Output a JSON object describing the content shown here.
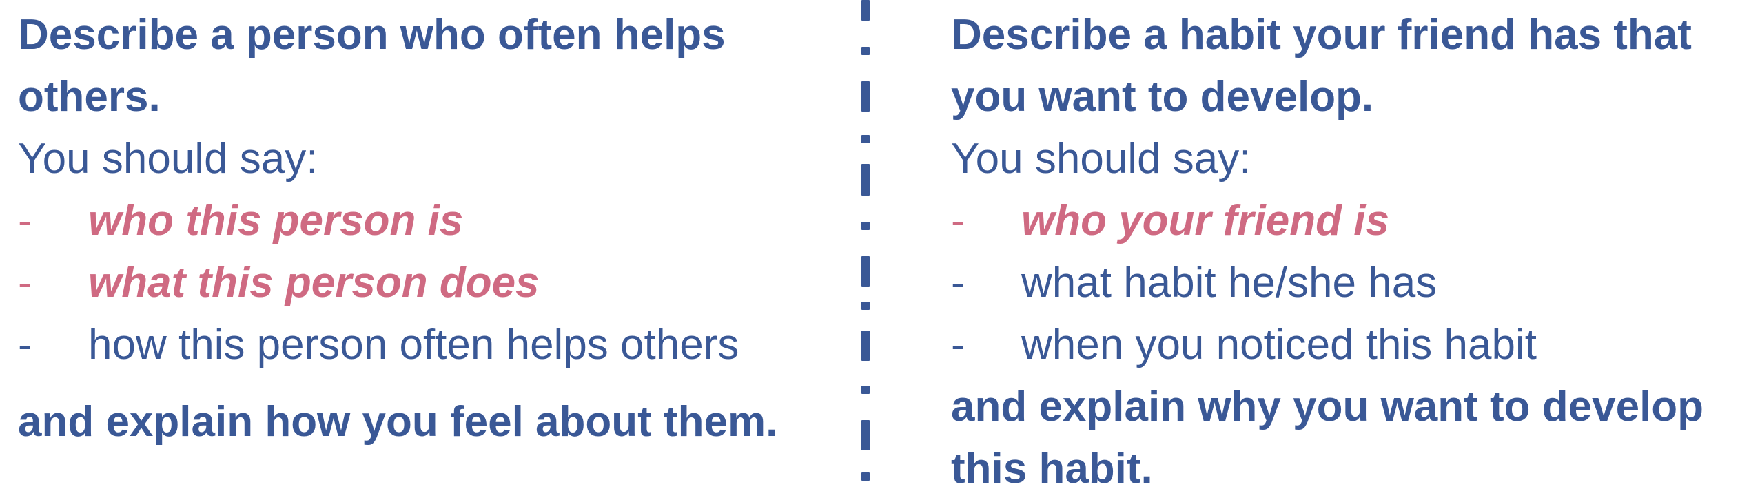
{
  "left_card": {
    "title": "Describe a person who often helps others.",
    "intro": "You should say:",
    "bullets": [
      {
        "dash": "-",
        "text": "who this person is",
        "highlighted": true
      },
      {
        "dash": "-",
        "text": "what this person does",
        "highlighted": true
      },
      {
        "dash": "-",
        "text": "how this person often helps others",
        "highlighted": false
      }
    ],
    "closing": "and explain how you feel about them."
  },
  "right_card": {
    "title": "Describe a habit your friend has that you want to develop.",
    "intro": "You should say:",
    "bullets": [
      {
        "dash": "-",
        "text": "who your friend is",
        "highlighted": true
      },
      {
        "dash": "-",
        "text": "what habit he/she has",
        "highlighted": false
      },
      {
        "dash": "-",
        "text": "when you noticed this habit",
        "highlighted": false
      }
    ],
    "closing": "and explain why you want to develop this habit."
  },
  "colors": {
    "text": "#3a5896",
    "highlight": "#cf6a82",
    "divider": "#3a5896"
  }
}
